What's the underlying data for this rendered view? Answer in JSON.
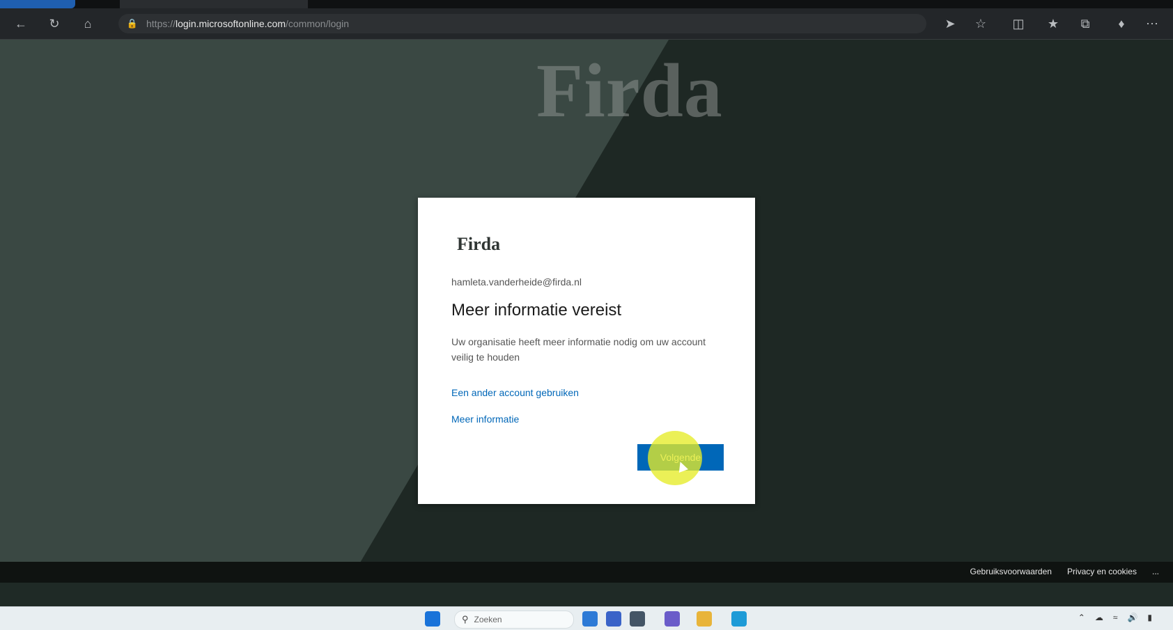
{
  "browser": {
    "url_prefix": "https://",
    "url_host": "login.microsoftonline.com",
    "url_path": "/common/login"
  },
  "page": {
    "background_logo": "Firda",
    "footer": {
      "links": [
        "Gebruiksvoorwaarden",
        "Privacy en cookies",
        "..."
      ]
    }
  },
  "dialog": {
    "logo": "Firda",
    "email": "hamleta.vanderheide@firda.nl",
    "title": "Meer informatie vereist",
    "description": "Uw organisatie heeft meer informatie nodig om uw account veilig te houden",
    "link_other_account": "Een ander account gebruiken",
    "link_more_info": "Meer informatie",
    "next_button": "Volgende"
  },
  "taskbar": {
    "search_placeholder": "Zoeken"
  },
  "colors": {
    "accent": "#0067b8",
    "highlight": "#e6ec28"
  }
}
